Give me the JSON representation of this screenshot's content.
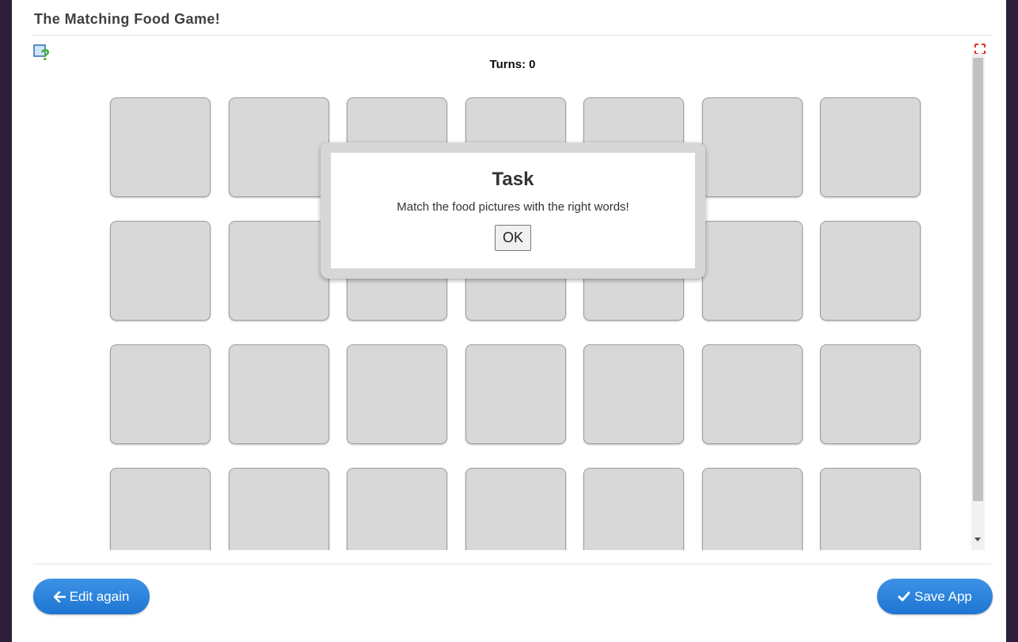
{
  "app": {
    "title": "The Matching Food Game!"
  },
  "game": {
    "turns_label": "Turns:",
    "turns_value": "0",
    "rows": 4,
    "cols": 7
  },
  "dialog": {
    "title": "Task",
    "message": "Match the food pictures with the right words!",
    "ok_label": "OK"
  },
  "footer": {
    "edit_label": "Edit again",
    "save_label": "Save App"
  },
  "icons": {
    "help": "help-icon",
    "fullscreen": "fullscreen-icon",
    "back": "arrow-left-icon",
    "save": "checkmark-icon"
  },
  "colors": {
    "accent": "#1f7ad4",
    "card": "#d8d8d8",
    "background": "#2d1e3b"
  }
}
